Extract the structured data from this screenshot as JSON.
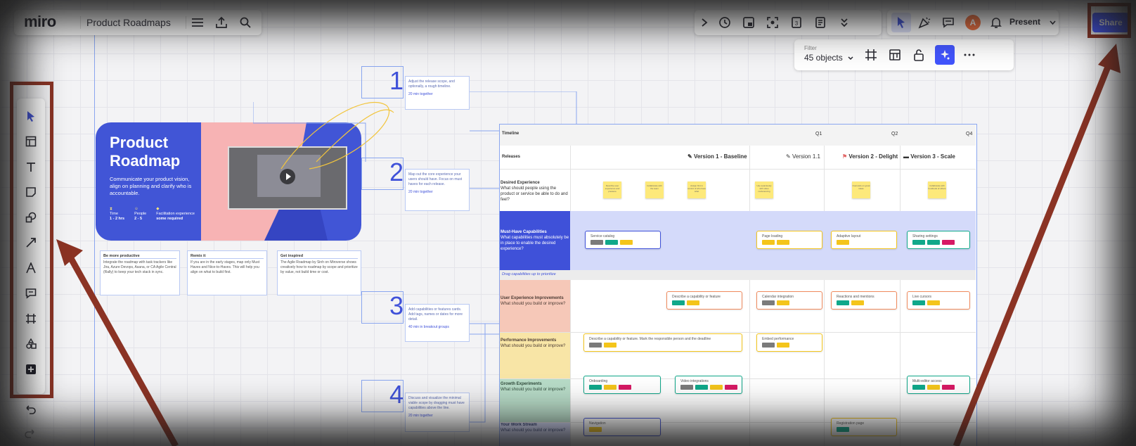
{
  "app": {
    "logo": "miro",
    "board_title": "Product Roadmaps"
  },
  "top_right": {
    "present_label": "Present",
    "share_label": "Share",
    "avatar_letter": "A"
  },
  "filter": {
    "label": "Filter",
    "value": "45 objects"
  },
  "hero": {
    "title_line1": "Product",
    "title_line2": "Roadmap",
    "subtitle": "Communicate your product vision, align on planning and clarify who is accountable.",
    "meta": [
      {
        "label": "Time",
        "value": "1 - 2 hrs"
      },
      {
        "label": "People",
        "value": "2 - 5"
      },
      {
        "label": "Facilitation experience",
        "value": "some required"
      }
    ]
  },
  "info_cards": [
    {
      "title": "Be more productive",
      "body": "Integrate the roadmap with task trackers like Jira, Azure Devops, Asana, or CA Agile Central (Rally) to keep your tech stack in sync."
    },
    {
      "title": "Remix it",
      "body": "If you are in the early stages, map only Must Haves and Nice-to-Haves. This will help you align on what to build first."
    },
    {
      "title": "Get inspired",
      "body": "The Agile Roadmap by Sinh on Miroverse shows creatively how to roadmap by scope and prioritize by value, not build time or cost."
    }
  ],
  "steps": [
    {
      "num": "1",
      "text": "Adjust the release scope, and optionally, a rough timeline.",
      "time": "20 min together"
    },
    {
      "num": "2",
      "text": "Map out the core experience your users should have. Focus on must haves for each release.",
      "time": "20 min together"
    },
    {
      "num": "3",
      "text": "Add capabilities or features cards. Add tags, names or dates for more detail.",
      "time": "40 min in breakout groups"
    },
    {
      "num": "4",
      "text": "Discuss and visualize the minimal viable scope by dragging must have capabilities above the line.",
      "time": "20 min together"
    }
  ],
  "roadmap": {
    "timeline_label": "Timeline",
    "quarters": [
      "Q1",
      "Q2",
      "Q4"
    ],
    "releases_label": "Releases",
    "versions": [
      "Version 1 - Baseline",
      "Version 1.1",
      "Version 2 - Delight",
      "Version 3 - Scale"
    ],
    "drag_note": "Drag capabilities up to prioritize",
    "rows": [
      {
        "title": "Desired Experience",
        "sub": "What should people using the product or service be able to do and feel?"
      },
      {
        "title": "Must-Have Capabilities",
        "sub": "What capabilities must absolutely be in place to enable the desired experience?"
      },
      {
        "title": "User Experience Improvements",
        "sub": "What should you build or improve?"
      },
      {
        "title": "Performance Improvements",
        "sub": "What should you build or improve?"
      },
      {
        "title": "Growth Experiments",
        "sub": "What should you build or improve?"
      },
      {
        "title": "Your Work Stream",
        "sub": "What should you build or improve?"
      }
    ],
    "stickies": [
      "Describe user experience and pressure",
      "Collaborate with the team",
      "Assign first in control of who have what",
      "Use seamlessly with video conferencing",
      "Ouorusdo on great ideas",
      "Collaborate with hundreds of others"
    ],
    "cards": [
      {
        "label": "Service catalog"
      },
      {
        "label": "Page loading"
      },
      {
        "label": "Adaptive layout"
      },
      {
        "label": "Sharing settings"
      },
      {
        "label": "Describe a capability or feature"
      },
      {
        "label": "Calendar integration"
      },
      {
        "label": "Reactions and mentions"
      },
      {
        "label": "Live cursors"
      },
      {
        "label": "Describe a capability or feature. Mark the responsible person and the deadline"
      },
      {
        "label": "Embed performance"
      },
      {
        "label": "Onboarding"
      },
      {
        "label": "Video integrations"
      },
      {
        "label": "Multi-editor access"
      },
      {
        "label": "Navigation"
      },
      {
        "label": "Registration page"
      }
    ]
  },
  "colors": {
    "brand_blue": "#3f51d9",
    "hero_pink": "#f7b3b4",
    "arrow": "#8b3324",
    "chip_gray": "#7b7b7b",
    "chip_teal": "#10a88a",
    "chip_yellow": "#f4c51b",
    "chip_magenta": "#d71964"
  }
}
